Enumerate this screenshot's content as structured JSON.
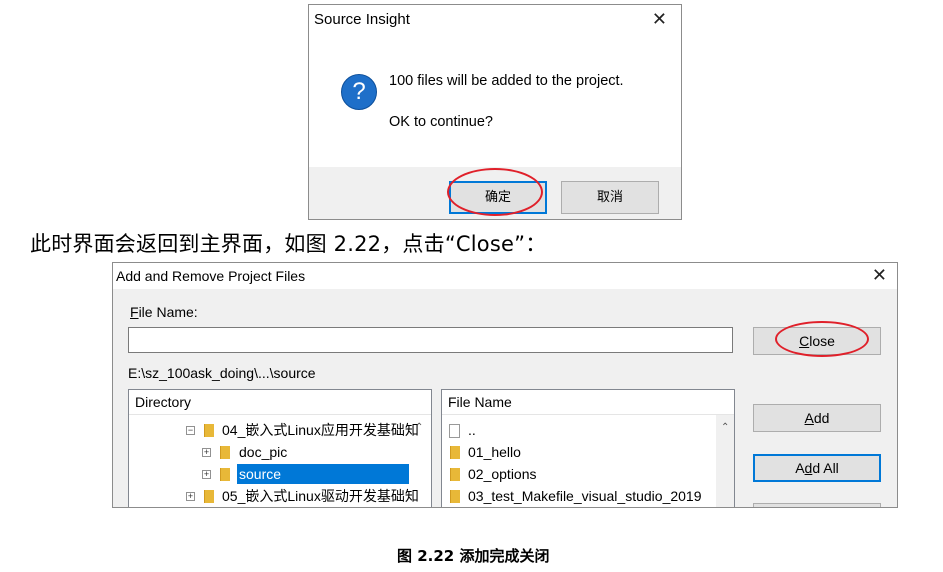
{
  "dialog1": {
    "title": "Source Insight",
    "close_glyph": "✕",
    "icon_glyph": "?",
    "message": "100 files will be added to the project.",
    "prompt": "OK to continue?",
    "ok_label": "确定",
    "cancel_label": "取消"
  },
  "instruction_text": "此时界面会返回到主界面，如图 2.22，点击“Close”：",
  "dialog2": {
    "title": "Add and Remove Project Files",
    "close_glyph": "✕",
    "file_name_label_accel": "F",
    "file_name_label_rest": "ile Name:",
    "file_name_value": "",
    "path": "E:\\sz_100ask_doing\\...\\source",
    "directory_header": "Directory",
    "file_name_header": "File Name",
    "buttons": {
      "close_accel": "C",
      "close_rest": "lose",
      "add_accel": "A",
      "add_rest": "dd",
      "add_all_pre": "A",
      "add_all_accel": "d",
      "add_all_rest": "d All"
    },
    "directory_items": [
      {
        "label": "04_嵌入式Linux应用开发基础知",
        "expander": "−"
      },
      {
        "label": "doc_pic",
        "expander": "+"
      },
      {
        "label": "source",
        "expander": "+"
      },
      {
        "label": "05_嵌入式Linux驱动开发基础知",
        "expander": "+"
      }
    ],
    "file_items": [
      {
        "label": ".."
      },
      {
        "label": "01_hello"
      },
      {
        "label": "02_options"
      },
      {
        "label": "03_test_Makefile_visual_studio_2019"
      }
    ]
  },
  "figure_caption": "图 2.22 添加完成关闭",
  "colors": {
    "accent": "#0078d7",
    "annotation": "#e0202a",
    "folder": "#e8b838",
    "help_icon": "#1e6fc9"
  }
}
